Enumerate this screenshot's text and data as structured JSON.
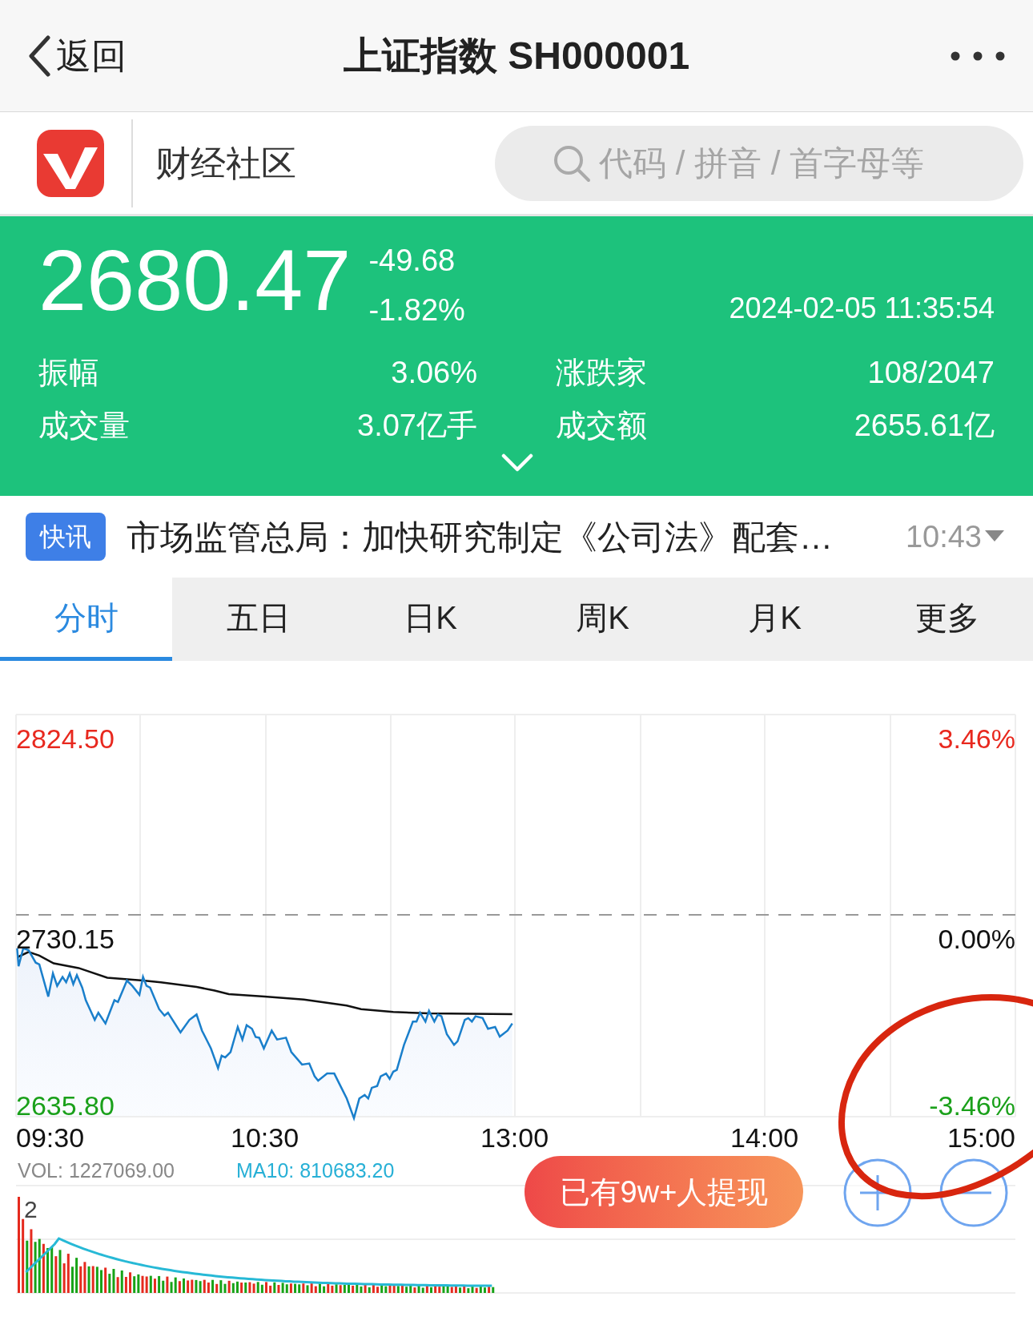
{
  "header": {
    "back_label": "返回",
    "title": "上证指数 SH000001"
  },
  "brand": {
    "name": "财经社区",
    "search": {
      "placeholder": "代码 / 拼音 / 首字母等"
    }
  },
  "quote": {
    "price": "2680.47",
    "change": "-49.68",
    "change_pct": "-1.82%",
    "timestamp": "2024-02-05 11:35:54",
    "stats": [
      {
        "label": "振幅",
        "value": "3.06%"
      },
      {
        "label": "涨跌家",
        "value": "108/2047"
      },
      {
        "label": "成交量",
        "value": "3.07亿手"
      },
      {
        "label": "成交额",
        "value": "2655.61亿"
      }
    ]
  },
  "news": {
    "badge": "快讯",
    "headline": "市场监管总局：加快研究制定《公司法》配套…",
    "time": "10:43"
  },
  "tabs": [
    {
      "label": "分时",
      "selected": true
    },
    {
      "label": "五日",
      "selected": false
    },
    {
      "label": "日K",
      "selected": false
    },
    {
      "label": "周K",
      "selected": false
    },
    {
      "label": "月K",
      "selected": false
    },
    {
      "label": "更多",
      "selected": false
    }
  ],
  "chart": {
    "high_price": "2824.50",
    "high_pct": "3.46%",
    "base_price": "2730.15",
    "base_pct": "0.00%",
    "low_price": "2635.80",
    "low_pct": "-3.46%",
    "times": [
      "09:30",
      "10:30",
      "13:00",
      "14:00",
      "15:00"
    ],
    "volume_label": "VOL: 1227069.00",
    "ma_label": "MA10: 810683.20",
    "volume_axis": "2"
  },
  "promo_button": "已有9w+人提现"
}
